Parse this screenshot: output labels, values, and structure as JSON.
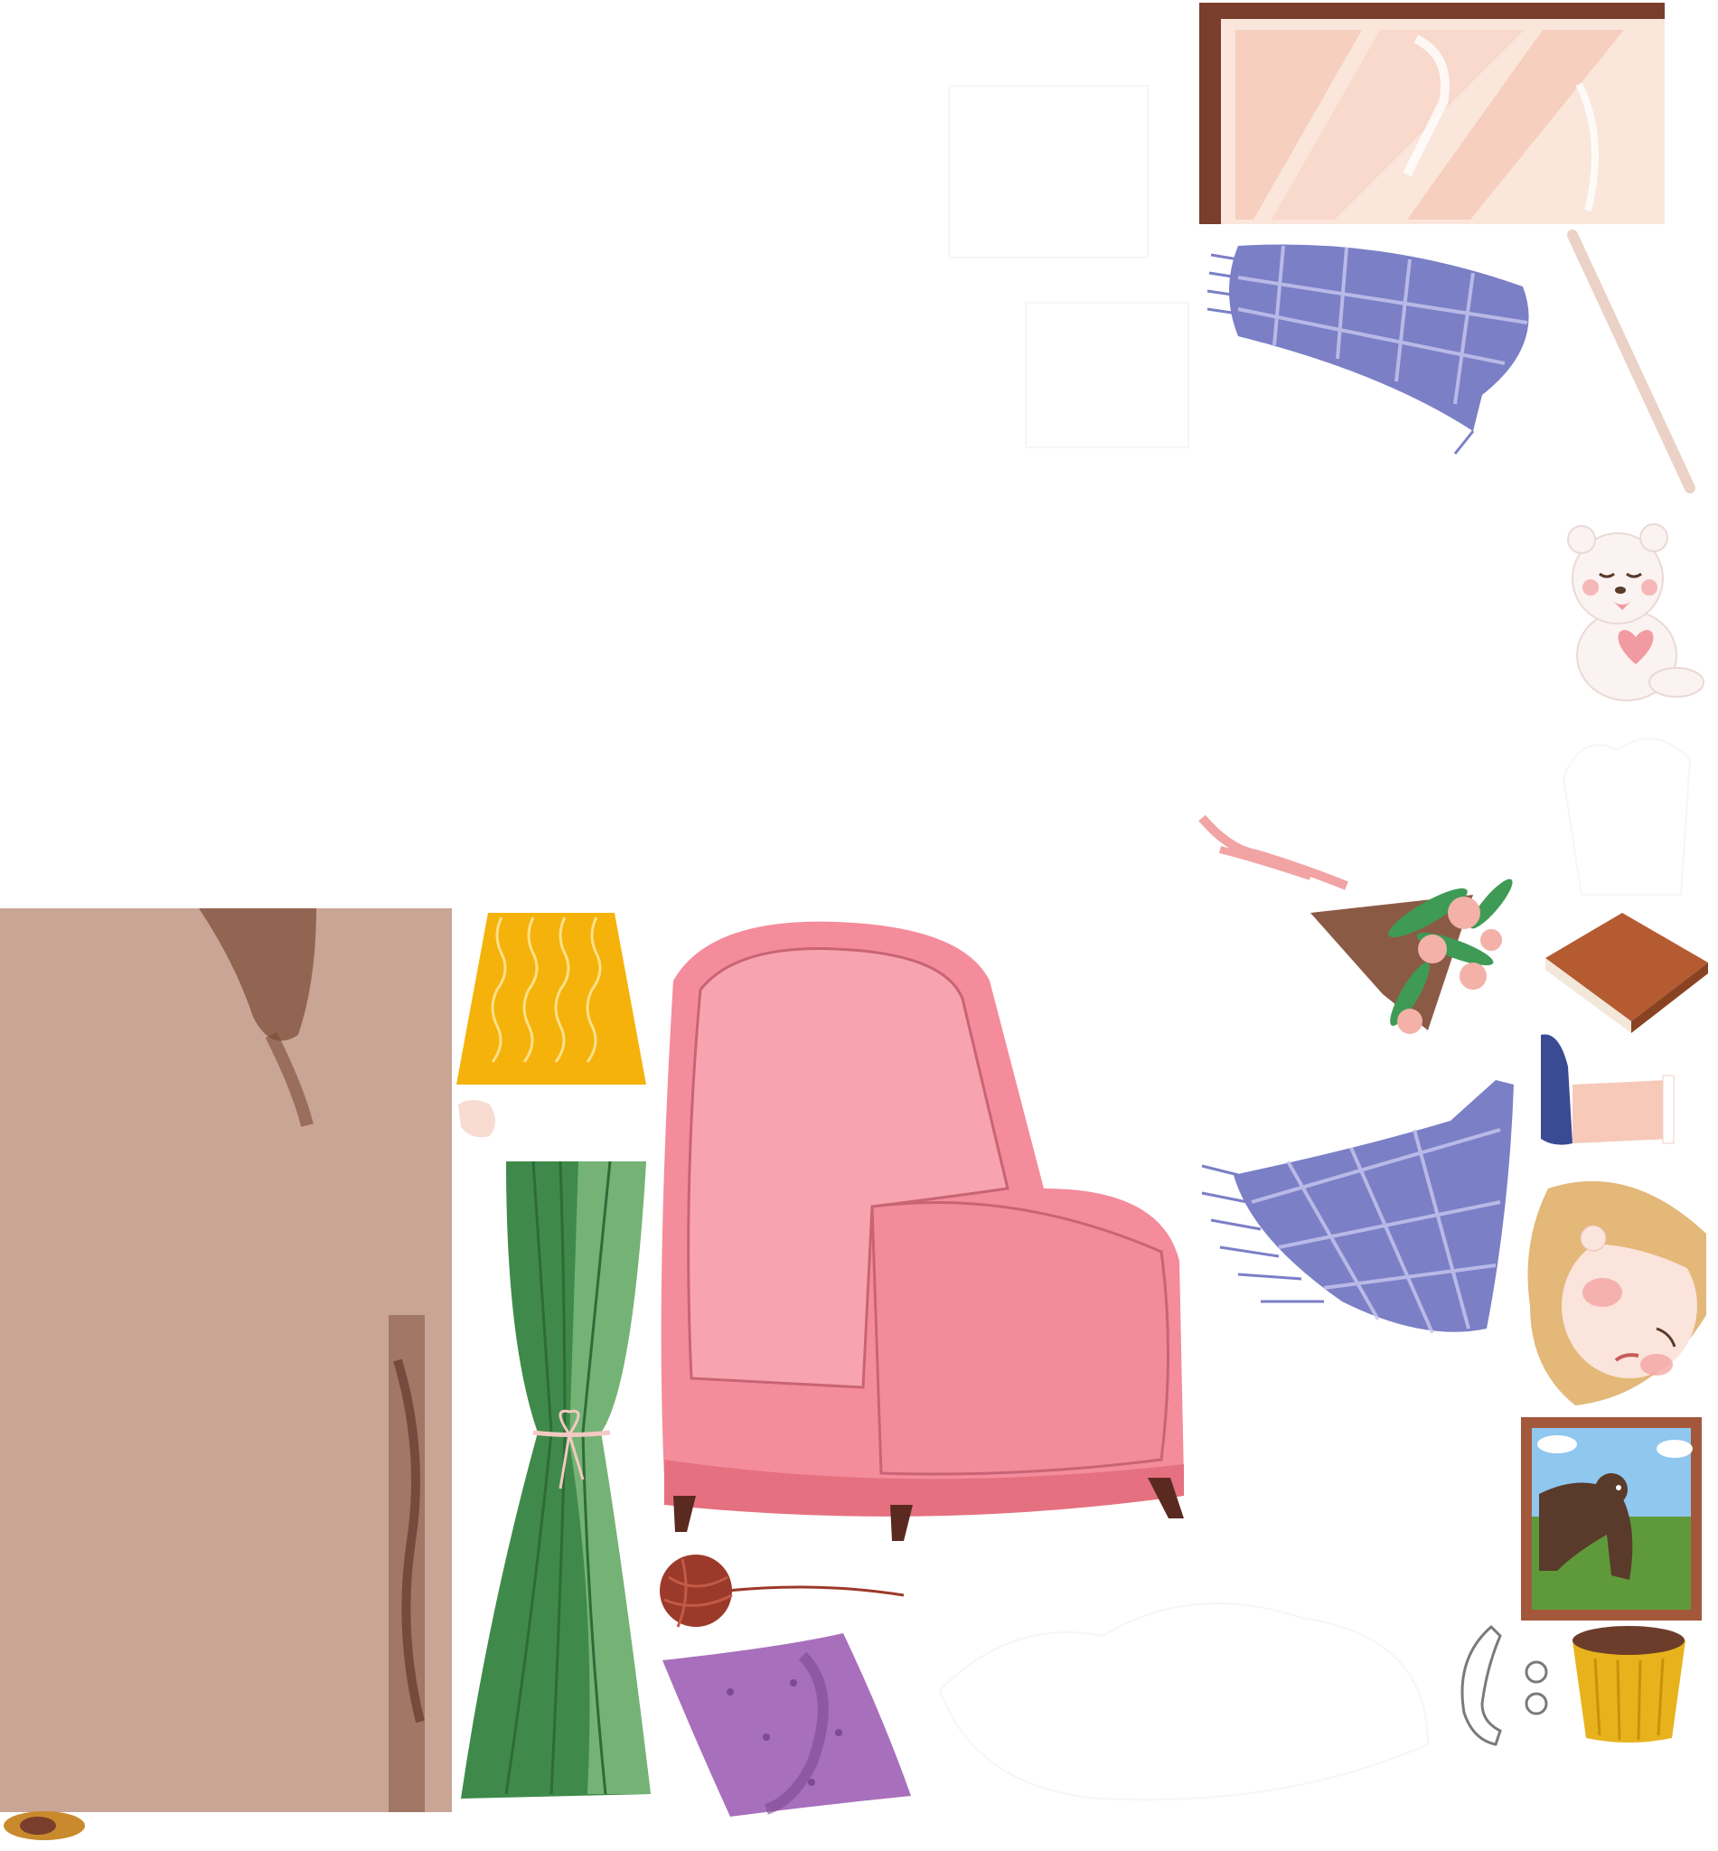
{
  "sheet": {
    "background": "#ffffff",
    "sprites": [
      {
        "name": "window-sprite",
        "colors": {
          "frame": "#7a3e2c",
          "glass": "#f6cfbf",
          "glass_light": "#fbe6dc"
        }
      },
      {
        "name": "plaid-blanket-folded-sprite",
        "colors": {
          "fabric": "#7b7fc6",
          "stripe": "#c9c8f0"
        }
      },
      {
        "name": "curtain-rod-sprite",
        "colors": {
          "rod": "#e7c6b9"
        }
      },
      {
        "name": "teddy-bear-sprite",
        "colors": {
          "body": "#fbf3f1",
          "heart": "#f29aa2",
          "cheek": "#f6b7b8"
        }
      },
      {
        "name": "flower-bouquet-sprite",
        "colors": {
          "wrap": "#8b5a45",
          "leaves": "#3f9a55",
          "flowers": "#f3b1a8",
          "ribbon": "#f2a3a3"
        }
      },
      {
        "name": "book-sprite",
        "colors": {
          "cover": "#b55b31",
          "pages": "#f2e7d9"
        }
      },
      {
        "name": "leg-with-sneaker-sprite",
        "colors": {
          "shoe": "#3a4a93",
          "skin": "#f6c9b9"
        }
      },
      {
        "name": "plaid-blanket-draped-sprite",
        "colors": {
          "fabric": "#7b7fc6",
          "stripe": "#c9c8f0"
        }
      },
      {
        "name": "sleeping-girl-head-sprite",
        "colors": {
          "hair": "#e3b878",
          "skin": "#fbe4db",
          "blush": "#f29b9b"
        }
      },
      {
        "name": "framed-bear-painting-sprite",
        "colors": {
          "frame": "#a4583b",
          "sky": "#8fc7ef",
          "grass": "#5e9a3a",
          "bear": "#5a3a2a"
        }
      },
      {
        "name": "coffee-cup-sprite",
        "colors": {
          "cup": "#e7b21b",
          "coffee": "#6b3d2a"
        }
      },
      {
        "name": "cup-handle-sprite",
        "colors": {
          "line": "#7a7a7a"
        }
      },
      {
        "name": "wooden-door-sprite",
        "colors": {
          "wood": "#c9a596",
          "grain": "#7a4a35"
        }
      },
      {
        "name": "floor-lamp-shade-sprite",
        "colors": {
          "shade": "#f5b20a",
          "waves": "#fde08a"
        }
      },
      {
        "name": "hand-sprite",
        "colors": {
          "skin": "#f8dcd2"
        }
      },
      {
        "name": "green-curtain-sprite",
        "colors": {
          "fabric": "#3f8a4a",
          "light": "#8cc487",
          "tie": "#f3c9c3"
        }
      },
      {
        "name": "pink-armchair-sprite",
        "colors": {
          "fabric": "#f48c9b",
          "trim": "#e5707f",
          "legs": "#5a2a20"
        }
      },
      {
        "name": "yarn-ball-sprite",
        "colors": {
          "yarn": "#9b3a2a"
        }
      },
      {
        "name": "purple-cushion-sprite",
        "colors": {
          "fabric": "#a86fbc",
          "dark": "#7d4a93"
        }
      },
      {
        "name": "slipper-sprite",
        "colors": {
          "body": "#c98a2d",
          "inner": "#7a3e2c"
        }
      }
    ]
  }
}
